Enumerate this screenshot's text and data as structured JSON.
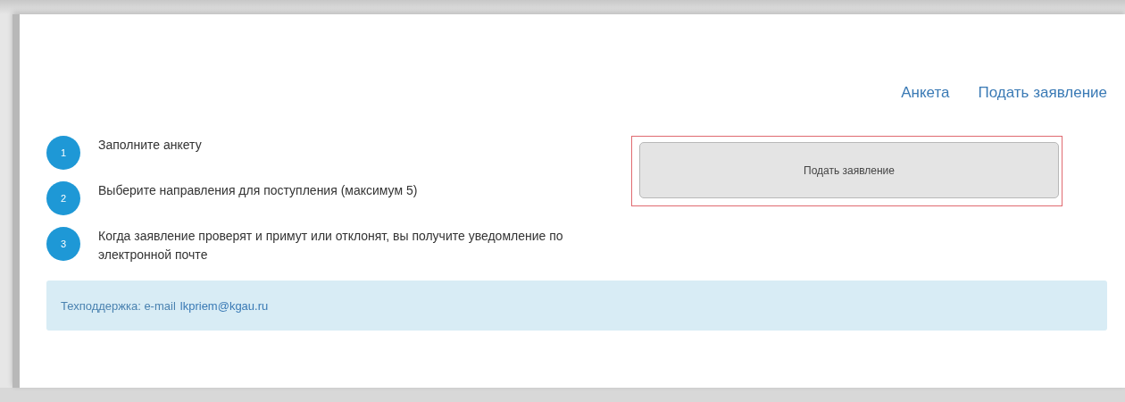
{
  "nav": [
    {
      "label": "Анкета"
    },
    {
      "label": "Подать заявление"
    }
  ],
  "steps": [
    {
      "number": "1",
      "text": "Заполните анкету"
    },
    {
      "number": "2",
      "text": "Выберите направления для поступления (максимум 5)"
    },
    {
      "number": "3",
      "text": "Когда заявление проверят и примут или отклонят, вы получите уведомление по электронной почте"
    }
  ],
  "submit_button": {
    "label": "Подать заявление",
    "highlighted": true
  },
  "support": {
    "label": "Техподдержка: e-mail",
    "email": "lkpriem@kgau.ru"
  }
}
